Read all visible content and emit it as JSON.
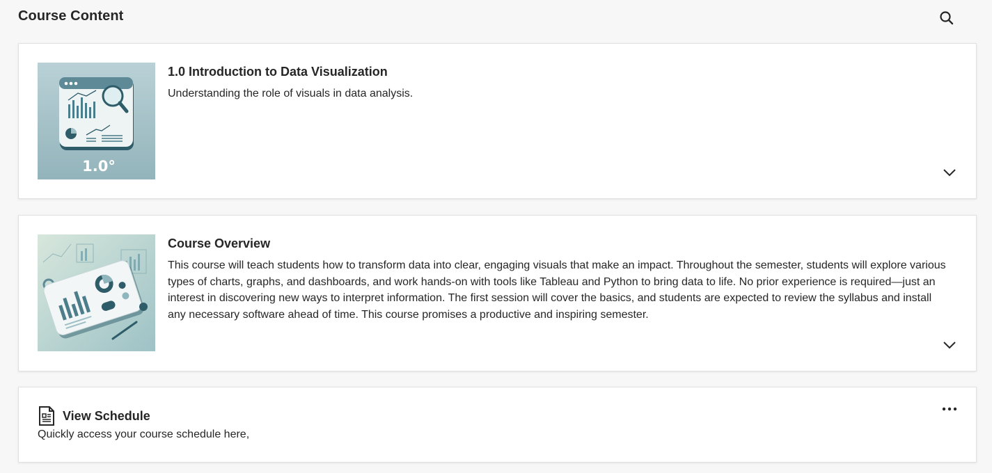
{
  "header": {
    "title": "Course Content",
    "search_icon": "search-icon"
  },
  "items": [
    {
      "title": "1.0 Introduction to Data Visualization",
      "description": "Understanding the role of visuals in data analysis.",
      "thumbnail_label": "1.0°",
      "expand_icon": "chevron-down-icon"
    },
    {
      "title": "Course Overview",
      "description": "This course will teach students how to transform data into clear, engaging visuals that make an impact. Throughout the semester, students will explore various types of charts, graphs, and dashboards, and work hands-on with tools like Tableau and Python to bring data to life. No prior experience is required—just an interest in discovering new ways to interpret information. The first session will cover the basics, and students are expected to review the syllabus and install any necessary software ahead of time. This course promises a productive and inspiring semester.",
      "expand_icon": "chevron-down-icon"
    }
  ],
  "schedule": {
    "title": "View Schedule",
    "description": "Quickly access your course schedule here,",
    "icon": "document-icon",
    "more_icon": "more-options-icon"
  },
  "colors": {
    "background": "#f7f7f7",
    "card": "#ffffff",
    "text": "#262626",
    "thumbnail_bg": "#a9c4c9"
  }
}
